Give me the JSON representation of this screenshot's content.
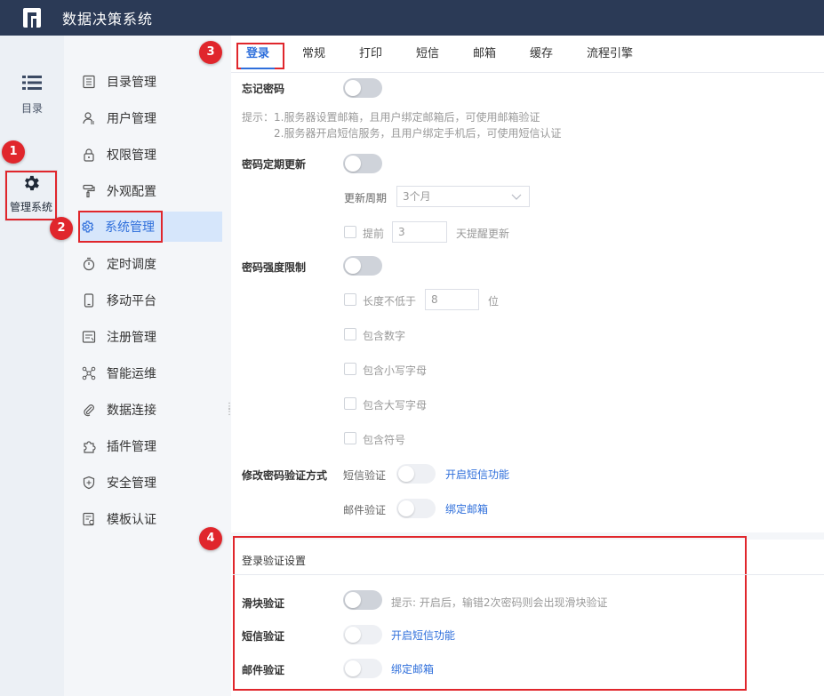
{
  "app": {
    "title": "数据决策系统"
  },
  "rail": {
    "items": [
      {
        "label": "目录",
        "icon": "list-icon"
      },
      {
        "label": "管理系统",
        "icon": "gear-icon"
      }
    ]
  },
  "menu": {
    "items": [
      {
        "label": "目录管理",
        "icon": "catalog-icon"
      },
      {
        "label": "用户管理",
        "icon": "user-icon"
      },
      {
        "label": "权限管理",
        "icon": "lock-icon"
      },
      {
        "label": "外观配置",
        "icon": "paint-roller-icon"
      },
      {
        "label": "系统管理",
        "icon": "settings-icon",
        "active": true
      },
      {
        "label": "定时调度",
        "icon": "timer-icon"
      },
      {
        "label": "移动平台",
        "icon": "mobile-icon"
      },
      {
        "label": "注册管理",
        "icon": "register-icon"
      },
      {
        "label": "智能运维",
        "icon": "network-icon"
      },
      {
        "label": "数据连接",
        "icon": "paperclip-icon"
      },
      {
        "label": "插件管理",
        "icon": "plugin-icon"
      },
      {
        "label": "安全管理",
        "icon": "shield-icon"
      },
      {
        "label": "模板认证",
        "icon": "template-certify-icon"
      }
    ]
  },
  "tabs": [
    "登录",
    "常规",
    "打印",
    "短信",
    "邮箱",
    "缓存",
    "流程引擎"
  ],
  "settings": {
    "forgot_password": "忘记密码",
    "hint_prefix": "提示：",
    "hint_line1": "1.服务器设置邮箱，且用户绑定邮箱后，可使用邮箱验证",
    "hint_line2": "2.服务器开启短信服务，且用户绑定手机后，可使用短信认证",
    "password_update": "密码定期更新",
    "update_period_label": "更新周期",
    "update_period_value": "3个月",
    "advance_label": "提前",
    "advance_value": "3",
    "advance_suffix": "天提醒更新",
    "strength_limit": "密码强度限制",
    "min_length_label": "长度不低于",
    "min_length_value": "8",
    "min_length_unit": "位",
    "include_digits": "包含数字",
    "include_lower": "包含小写字母",
    "include_upper": "包含大写字母",
    "include_symbols": "包含符号",
    "modify_verify": "修改密码验证方式",
    "sms_verify": "短信验证",
    "sms_link": "开启短信功能",
    "email_verify": "邮件验证",
    "email_link": "绑定邮箱"
  },
  "login_verify": {
    "title": "登录验证设置",
    "slider_label": "滑块验证",
    "slider_hint": "提示: 开启后，输错2次密码则会出现滑块验证",
    "sms_label": "短信验证",
    "sms_link": "开启短信功能",
    "email_label": "邮件验证",
    "email_link": "绑定邮箱"
  },
  "badges": [
    "1",
    "2",
    "3",
    "4"
  ],
  "colors": {
    "topbar": "#2b3a56",
    "accent": "#2f6fdb",
    "highlight": "#e0262c",
    "active_bg": "#d6e6fb"
  }
}
